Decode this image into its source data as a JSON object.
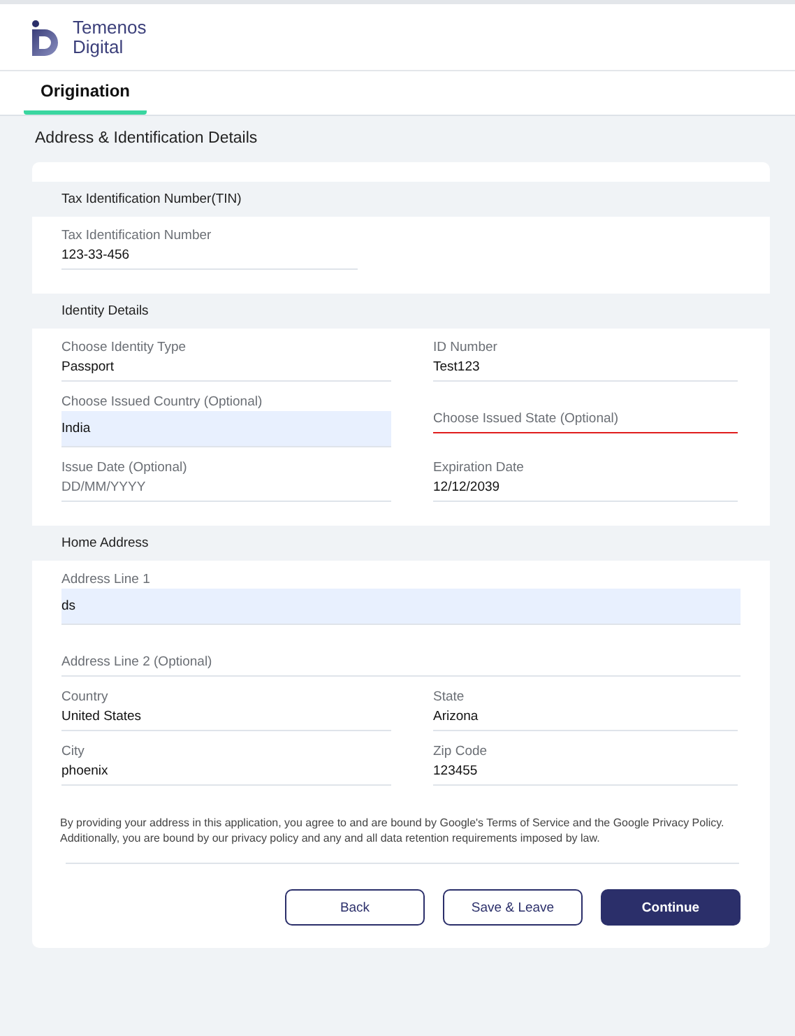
{
  "logo": {
    "lines": [
      "Temenos",
      "Digital"
    ]
  },
  "tabs": [
    {
      "label": "Origination",
      "selected": true
    }
  ],
  "page_title": "Address & Identification Details",
  "sections": [
    {
      "title": "Tax Identification Number(TIN)",
      "rows": [
        [
          {
            "label": "Tax Identification Number",
            "value": "123-33-456",
            "error": false,
            "autofilled": false,
            "wide": false
          }
        ]
      ]
    },
    {
      "title": "Identity Details",
      "rows": [
        [
          {
            "label": "Choose Identity Type",
            "value": "Passport",
            "error": false,
            "autofilled": false
          },
          {
            "label": "ID Number",
            "value": "Test123",
            "error": false,
            "autofilled": false
          }
        ],
        [
          {
            "label": "Choose Issued Country  (Optional)",
            "value": "India",
            "error": false,
            "autofilled": true
          },
          {
            "label": "Choose Issued State  (Optional)",
            "error": true,
            "autofilled": false
          }
        ],
        [
          {
            "label": "Issue Date  (Optional)",
            "placeholder": "DD/MM/YYYY",
            "error": false,
            "autofilled": false
          },
          {
            "label": "Expiration Date",
            "value": "12/12/2039",
            "error": false,
            "autofilled": false
          }
        ]
      ]
    },
    {
      "title": "Home Address",
      "rows": [
        [
          {
            "label": "Address Line 1",
            "value": "ds",
            "error": false,
            "autofilled": true,
            "wide": true
          }
        ],
        [
          {
            "label": "Address Line 2 (Optional)",
            "error": false,
            "autofilled": false,
            "wide": true
          }
        ],
        [
          {
            "label": "Country",
            "value": "United States",
            "error": false,
            "autofilled": false
          },
          {
            "label": "State",
            "value": "Arizona",
            "error": false,
            "autofilled": false
          }
        ],
        [
          {
            "label": "City",
            "value": "phoenix",
            "error": false,
            "autofilled": false
          },
          {
            "label": "Zip Code",
            "value": "123455",
            "error": false,
            "autofilled": false
          }
        ]
      ]
    }
  ],
  "disclaimer": "By providing your address in this application, you agree to and are bound by Google's Terms of Service and the Google Privacy Policy. Additionally, you are bound by our privacy policy and any and all data retention requirements imposed by law.",
  "buttons": [
    {
      "label": "Back",
      "kind": "secondary"
    },
    {
      "label": "Save & Leave",
      "kind": "secondary"
    },
    {
      "label": "Continue",
      "kind": "primary"
    }
  ]
}
